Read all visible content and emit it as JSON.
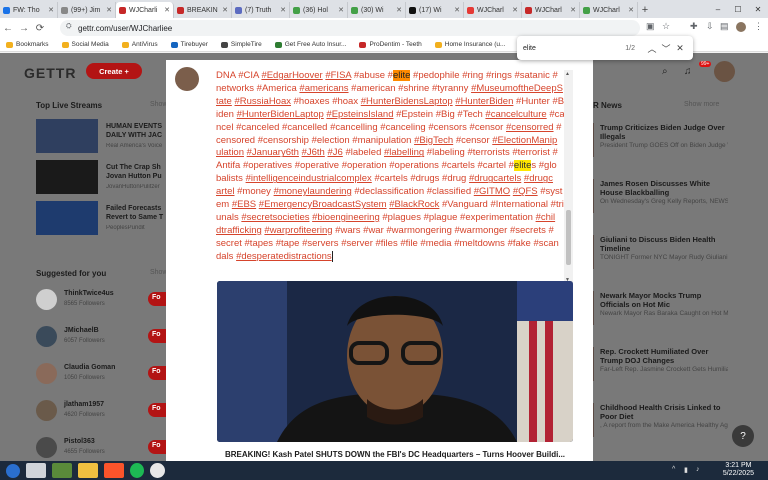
{
  "browser": {
    "tabs": [
      {
        "label": "FW: Tho",
        "color": "#1a73e8",
        "active": false
      },
      {
        "label": "(99+) Jim",
        "color": "#888888",
        "active": false
      },
      {
        "label": "WJCharli",
        "color": "#c62828",
        "active": true
      },
      {
        "label": "BREAKIN",
        "color": "#c62828",
        "active": false
      },
      {
        "label": "(7) Truth",
        "color": "#5c6bc0",
        "active": false
      },
      {
        "label": "(36) Hol",
        "color": "#43a047",
        "active": false
      },
      {
        "label": "(30) Wi",
        "color": "#43a047",
        "active": false
      },
      {
        "label": "(17) Wi",
        "color": "#111111",
        "active": false
      },
      {
        "label": "WJCharl",
        "color": "#e53935",
        "active": false
      },
      {
        "label": "WJCharl",
        "color": "#c62828",
        "active": false
      },
      {
        "label": "WJCharl",
        "color": "#43a047",
        "active": false
      }
    ],
    "url": "gettr.com/user/WJCharliee",
    "bookmarks": [
      {
        "label": "Bookmarks",
        "color": "#f2b01e"
      },
      {
        "label": "Social Media",
        "color": "#f2b01e"
      },
      {
        "label": "AntiVirus",
        "color": "#f2b01e"
      },
      {
        "label": "Tirebuyer",
        "color": "#1565c0"
      },
      {
        "label": "SimpleTire",
        "color": "#444444"
      },
      {
        "label": "Get Free Auto Insur...",
        "color": "#2e7d32"
      },
      {
        "label": "ProDentim - Teeth",
        "color": "#c62828"
      },
      {
        "label": "Home Insurance (u...",
        "color": "#f2b01e"
      }
    ],
    "find": {
      "query": "elite",
      "count": "1/2"
    }
  },
  "gettr": {
    "logo": "GETTR",
    "create_label": "Create +",
    "notif_badge": "99+",
    "live_title": "Top Live Streams",
    "show_more": "Show",
    "streams": [
      {
        "title": "HUMAN EVENTS DAILY WITH JAC",
        "sub": "Real America's Voice",
        "thumb": "#2f3f5f"
      },
      {
        "title": "Cut The Crap Sh Jovan Hutton Pu",
        "sub": "JovanHuttonPulitzer",
        "thumb": "#1a1a1a"
      },
      {
        "title": "Failed Forecasts Revert to Same T",
        "sub": "PeoplesPundit",
        "thumb": "#1e3b6e"
      }
    ],
    "suggested_title": "Suggested for you",
    "suggested_show": "Show",
    "follow_label": "Fo",
    "users": [
      {
        "name": "ThinkTwice4us",
        "followers": "8565 Followers",
        "color": "#cfcfcf"
      },
      {
        "name": "JMichaelB",
        "followers": "6057 Followers",
        "color": "#3a4a5a"
      },
      {
        "name": "Claudia Goman",
        "followers": "1050 Followers",
        "color": "#8a6a5a"
      },
      {
        "name": "jlatham1957",
        "followers": "4620 Followers",
        "color": "#6a5a4a"
      },
      {
        "name": "Pistol363",
        "followers": "4655 Followers",
        "color": "#4a4a4a"
      }
    ],
    "news_title": "R News",
    "news_show": "Show more",
    "news": [
      {
        "title": "Trump Criticizes Biden Judge Over Illegals",
        "desc": "President Trump GOES Off on Biden Judge Who Ordered B..."
      },
      {
        "title": "James Rosen Discusses White House Blackballing",
        "desc": "On Wednesday's Greg Kelly Reports, NEWSMAX Chief..."
      },
      {
        "title": "Giuliani to Discuss Biden Health Timeline",
        "desc": "TONIGHT Former NYC Mayor Rudy Giuliani will join Finnerty to weigh..."
      },
      {
        "title": "Newark Mayor Mocks Trump Officials on Hot Mic",
        "desc": "Newark Mayor Ras Baraka Caught on Hot Mic Mocking Trump DOJ..."
      },
      {
        "title": "Rep. Crockett Humiliated Over Trump DOJ Changes",
        "desc": "Far-Left Rep. Jasmine Crockett Gets Humiliated by Harmeet..."
      },
      {
        "title": "Childhood Health Crisis Linked to Poor Diet",
        "desc": ", A report from the Make America Healthy Again MAHA Commissi..."
      }
    ]
  },
  "post": {
    "video_caption": "BREAKING! Kash Patel SHUTS DOWN the FBI's DC Headquarters – Turns Hoover Buildi...",
    "tokens": [
      {
        "t": "DNA",
        "k": "t"
      },
      {
        "t": "#CIA",
        "k": "t"
      },
      {
        "t": "#EdgarHoover",
        "k": "u"
      },
      {
        "t": "#FISA",
        "k": "u"
      },
      {
        "t": "#abuse",
        "k": "t"
      },
      {
        "t": "#",
        "k": "t",
        "join": true
      },
      {
        "t": "elite",
        "k": "cur"
      },
      {
        "t": "#pedophile",
        "k": "t"
      },
      {
        "t": "#ring",
        "k": "t"
      },
      {
        "t": "#rings",
        "k": "t"
      },
      {
        "t": "#satanic",
        "k": "t"
      },
      {
        "t": "#",
        "k": "t"
      },
      {
        "t": "networks",
        "k": "t"
      },
      {
        "t": "#America",
        "k": "t"
      },
      {
        "t": "#americans",
        "k": "u"
      },
      {
        "t": "#american",
        "k": "t"
      },
      {
        "t": "#shrine",
        "k": "t"
      },
      {
        "t": "#tyranny",
        "k": "t"
      },
      {
        "t": "#MuseumoftheDeepS",
        "k": "u"
      },
      {
        "t": "tate",
        "k": "u"
      },
      {
        "t": "#RussiaHoax",
        "k": "u"
      },
      {
        "t": "#hoaxes",
        "k": "t"
      },
      {
        "t": "#hoax",
        "k": "t"
      },
      {
        "t": "#HunterBidensLaptop",
        "k": "u"
      },
      {
        "t": "#HunterBiden",
        "k": "u"
      },
      {
        "t": "#Hunter",
        "k": "t"
      },
      {
        "t": "#B",
        "k": "t"
      },
      {
        "t": "iden",
        "k": "t"
      },
      {
        "t": "#HunterBidenLaptop",
        "k": "u"
      },
      {
        "t": "#EpsteinsIsland",
        "k": "u"
      },
      {
        "t": "#Epstein",
        "k": "t"
      },
      {
        "t": "#Big",
        "k": "t"
      },
      {
        "t": "#Tech",
        "k": "t"
      },
      {
        "t": "#cancelculture",
        "k": "u"
      },
      {
        "t": "#ca",
        "k": "t"
      },
      {
        "t": "ncel",
        "k": "t"
      },
      {
        "t": "#canceled",
        "k": "t"
      },
      {
        "t": "#cancelled",
        "k": "t"
      },
      {
        "t": "#cancelling",
        "k": "t"
      },
      {
        "t": "#canceling",
        "k": "t"
      },
      {
        "t": "#censors",
        "k": "t"
      },
      {
        "t": "#censor",
        "k": "t"
      },
      {
        "t": "#censorred",
        "k": "u"
      },
      {
        "t": "#",
        "k": "t"
      },
      {
        "t": "censored",
        "k": "t"
      },
      {
        "t": "#censorship",
        "k": "t"
      },
      {
        "t": "#election",
        "k": "t"
      },
      {
        "t": "#manipulation",
        "k": "t"
      },
      {
        "t": "#BigTech",
        "k": "u"
      },
      {
        "t": "#censor",
        "k": "t"
      },
      {
        "t": "#ElectionManip",
        "k": "u"
      },
      {
        "t": "ulation",
        "k": "u"
      },
      {
        "t": "#January6th",
        "k": "u"
      },
      {
        "t": "#J6th",
        "k": "u"
      },
      {
        "t": "#J6",
        "k": "u"
      },
      {
        "t": "#labeled",
        "k": "t"
      },
      {
        "t": "#labelling",
        "k": "u"
      },
      {
        "t": "#labeling",
        "k": "t"
      },
      {
        "t": "#terrorists",
        "k": "t"
      },
      {
        "t": "#terrorist",
        "k": "t"
      },
      {
        "t": "#",
        "k": "t"
      },
      {
        "t": "Antifa",
        "k": "t"
      },
      {
        "t": "#operatives",
        "k": "t"
      },
      {
        "t": "#operative",
        "k": "t"
      },
      {
        "t": "#operation",
        "k": "t"
      },
      {
        "t": "#operations",
        "k": "t"
      },
      {
        "t": "#cartels",
        "k": "t"
      },
      {
        "t": "#cartel",
        "k": "t"
      },
      {
        "t": "#",
        "k": "t",
        "join": true
      },
      {
        "t": "elite",
        "k": "hl",
        "join": true
      },
      {
        "t": "s",
        "k": "t"
      },
      {
        "t": "#glo",
        "k": "t"
      },
      {
        "t": "balists",
        "k": "t"
      },
      {
        "t": "#intelligenceindustrialcomplex",
        "k": "u"
      },
      {
        "t": "#cartels",
        "k": "t"
      },
      {
        "t": "#drugs",
        "k": "t"
      },
      {
        "t": "#drug",
        "k": "t"
      },
      {
        "t": "#drugcartels",
        "k": "u"
      },
      {
        "t": "#drugc",
        "k": "u"
      },
      {
        "t": "artel",
        "k": "u"
      },
      {
        "t": "#money",
        "k": "t"
      },
      {
        "t": "#moneylaundering",
        "k": "u"
      },
      {
        "t": "#declassification",
        "k": "t"
      },
      {
        "t": "#classified",
        "k": "t"
      },
      {
        "t": "#GITMO",
        "k": "u"
      },
      {
        "t": "#QFS",
        "k": "u"
      },
      {
        "t": "#syst",
        "k": "t"
      },
      {
        "t": "em",
        "k": "t"
      },
      {
        "t": "#EBS",
        "k": "u"
      },
      {
        "t": "#EmergencyBroadcastSystem",
        "k": "u"
      },
      {
        "t": "#BlackRock",
        "k": "u"
      },
      {
        "t": "#Vanguard",
        "k": "t"
      },
      {
        "t": "#International",
        "k": "t"
      },
      {
        "t": "#trib",
        "k": "t"
      },
      {
        "t": "unals",
        "k": "t"
      },
      {
        "t": "#secretsocieties",
        "k": "u"
      },
      {
        "t": "#bioengineering",
        "k": "u"
      },
      {
        "t": "#plagues",
        "k": "t"
      },
      {
        "t": "#plague",
        "k": "t"
      },
      {
        "t": "#experimentation",
        "k": "t"
      },
      {
        "t": "#chil",
        "k": "u"
      },
      {
        "t": "dtrafficking",
        "k": "u"
      },
      {
        "t": "#warprofiteering",
        "k": "u"
      },
      {
        "t": "#wars",
        "k": "t"
      },
      {
        "t": "#war",
        "k": "t"
      },
      {
        "t": "#warmongering",
        "k": "t"
      },
      {
        "t": "#warmonger",
        "k": "t"
      },
      {
        "t": "#secrets",
        "k": "t"
      },
      {
        "t": "#",
        "k": "t"
      },
      {
        "t": "secret",
        "k": "t"
      },
      {
        "t": "#tapes",
        "k": "t"
      },
      {
        "t": "#tape",
        "k": "t"
      },
      {
        "t": "#servers",
        "k": "t"
      },
      {
        "t": "#server",
        "k": "t"
      },
      {
        "t": "#files",
        "k": "t"
      },
      {
        "t": "#file",
        "k": "t"
      },
      {
        "t": "#media",
        "k": "t"
      },
      {
        "t": "#meltdowns",
        "k": "t"
      },
      {
        "t": "#fake",
        "k": "t"
      },
      {
        "t": "#scan",
        "k": "t"
      },
      {
        "t": "dals",
        "k": "t"
      },
      {
        "t": "#desperatedistractions",
        "k": "u"
      }
    ]
  },
  "taskbar": {
    "time": "3:21 PM",
    "date": "5/22/2025"
  }
}
